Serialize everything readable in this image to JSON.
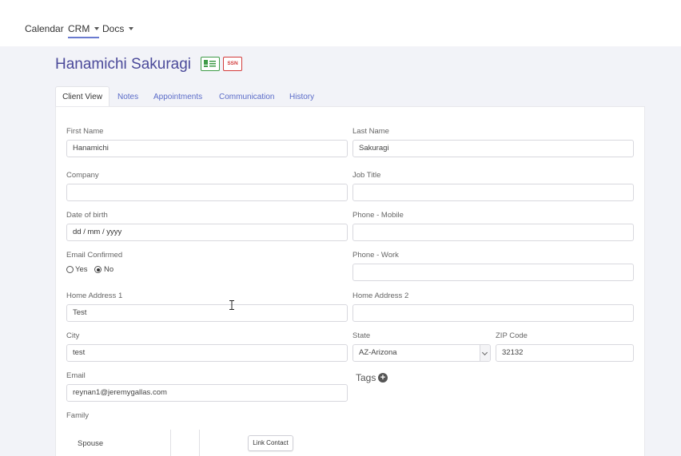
{
  "nav": {
    "items": [
      {
        "label": "Calendar"
      },
      {
        "label": "CRM"
      },
      {
        "label": "Docs"
      }
    ]
  },
  "client": {
    "name": "Hanamichi Sakuragi",
    "ssn_badge": "SSN"
  },
  "tabs": [
    "Client View",
    "Notes",
    "Appointments",
    "Communication",
    "History"
  ],
  "form": {
    "first_name": {
      "label": "First Name",
      "value": "Hanamichi"
    },
    "last_name": {
      "label": "Last Name",
      "value": "Sakuragi"
    },
    "company": {
      "label": "Company",
      "value": ""
    },
    "job_title": {
      "label": "Job Title",
      "value": ""
    },
    "dob": {
      "label": "Date of birth",
      "value": "dd / mm / yyyy"
    },
    "phone_mobile": {
      "label": "Phone - Mobile",
      "value": ""
    },
    "email_confirmed": {
      "label": "Email Confirmed",
      "yes": "Yes",
      "no": "No",
      "selected": "No"
    },
    "phone_work": {
      "label": "Phone - Work",
      "value": ""
    },
    "home_address_1": {
      "label": "Home Address 1",
      "value": "Test"
    },
    "home_address_2": {
      "label": "Home Address 2",
      "value": ""
    },
    "city": {
      "label": "City",
      "value": "test"
    },
    "state": {
      "label": "State",
      "value": "AZ-Arizona"
    },
    "zip": {
      "label": "ZIP Code",
      "value": "32132"
    },
    "email": {
      "label": "Email",
      "value": "reynan1@jeremygallas.com"
    },
    "tags": {
      "label": "Tags"
    },
    "family": {
      "label": "Family",
      "spouse": "Spouse",
      "link_button": "Link Contact"
    }
  },
  "colors": {
    "accent": "#4b4a9a",
    "tab_link": "#5a6bc8",
    "id_badge": "#3f9b48",
    "ssn_badge": "#d23b3b"
  }
}
